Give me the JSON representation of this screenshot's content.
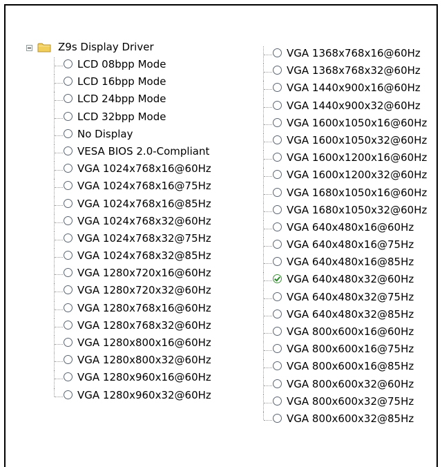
{
  "tree": {
    "root_label": "Z9s Display Driver",
    "left_items": [
      {
        "label": "LCD 08bpp Mode",
        "checked": false
      },
      {
        "label": "LCD 16bpp Mode",
        "checked": false
      },
      {
        "label": "LCD 24bpp Mode",
        "checked": false
      },
      {
        "label": "LCD 32bpp Mode",
        "checked": false
      },
      {
        "label": "No Display",
        "checked": false
      },
      {
        "label": "VESA BIOS 2.0-Compliant",
        "checked": false
      },
      {
        "label": "VGA 1024x768x16@60Hz",
        "checked": false
      },
      {
        "label": "VGA 1024x768x16@75Hz",
        "checked": false
      },
      {
        "label": "VGA 1024x768x16@85Hz",
        "checked": false
      },
      {
        "label": "VGA 1024x768x32@60Hz",
        "checked": false
      },
      {
        "label": "VGA 1024x768x32@75Hz",
        "checked": false
      },
      {
        "label": "VGA 1024x768x32@85Hz",
        "checked": false
      },
      {
        "label": "VGA 1280x720x16@60Hz",
        "checked": false
      },
      {
        "label": "VGA 1280x720x32@60Hz",
        "checked": false
      },
      {
        "label": "VGA 1280x768x16@60Hz",
        "checked": false
      },
      {
        "label": "VGA 1280x768x32@60Hz",
        "checked": false
      },
      {
        "label": "VGA 1280x800x16@60Hz",
        "checked": false
      },
      {
        "label": "VGA 1280x800x32@60Hz",
        "checked": false
      },
      {
        "label": "VGA 1280x960x16@60Hz",
        "checked": false
      },
      {
        "label": "VGA 1280x960x32@60Hz",
        "checked": false
      }
    ],
    "right_items": [
      {
        "label": "VGA 1368x768x16@60Hz",
        "checked": false
      },
      {
        "label": "VGA 1368x768x32@60Hz",
        "checked": false
      },
      {
        "label": "VGA 1440x900x16@60Hz",
        "checked": false
      },
      {
        "label": "VGA 1440x900x32@60Hz",
        "checked": false
      },
      {
        "label": "VGA 1600x1050x16@60Hz",
        "checked": false
      },
      {
        "label": "VGA 1600x1050x32@60Hz",
        "checked": false
      },
      {
        "label": "VGA 1600x1200x16@60Hz",
        "checked": false
      },
      {
        "label": "VGA 1600x1200x32@60Hz",
        "checked": false
      },
      {
        "label": "VGA 1680x1050x16@60Hz",
        "checked": false
      },
      {
        "label": "VGA 1680x1050x32@60Hz",
        "checked": false
      },
      {
        "label": "VGA 640x480x16@60Hz",
        "checked": false
      },
      {
        "label": "VGA 640x480x16@75Hz",
        "checked": false
      },
      {
        "label": "VGA 640x480x16@85Hz",
        "checked": false
      },
      {
        "label": "VGA 640x480x32@60Hz",
        "checked": true
      },
      {
        "label": "VGA 640x480x32@75Hz",
        "checked": false
      },
      {
        "label": "VGA 640x480x32@85Hz",
        "checked": false
      },
      {
        "label": "VGA 800x600x16@60Hz",
        "checked": false
      },
      {
        "label": "VGA 800x600x16@75Hz",
        "checked": false
      },
      {
        "label": "VGA 800x600x16@85Hz",
        "checked": false
      },
      {
        "label": "VGA 800x600x32@60Hz",
        "checked": false
      },
      {
        "label": "VGA 800x600x32@75Hz",
        "checked": false
      },
      {
        "label": "VGA 800x600x32@85Hz",
        "checked": false
      }
    ]
  },
  "icons": {
    "expander": "minus-box-icon",
    "folder": "folder-icon",
    "option": "radio-icon",
    "selected_option": "check-icon"
  },
  "colors": {
    "folder": "#f2cf5b",
    "checkmark": "#2a8a2a",
    "tree_line": "#9a9a9a"
  }
}
